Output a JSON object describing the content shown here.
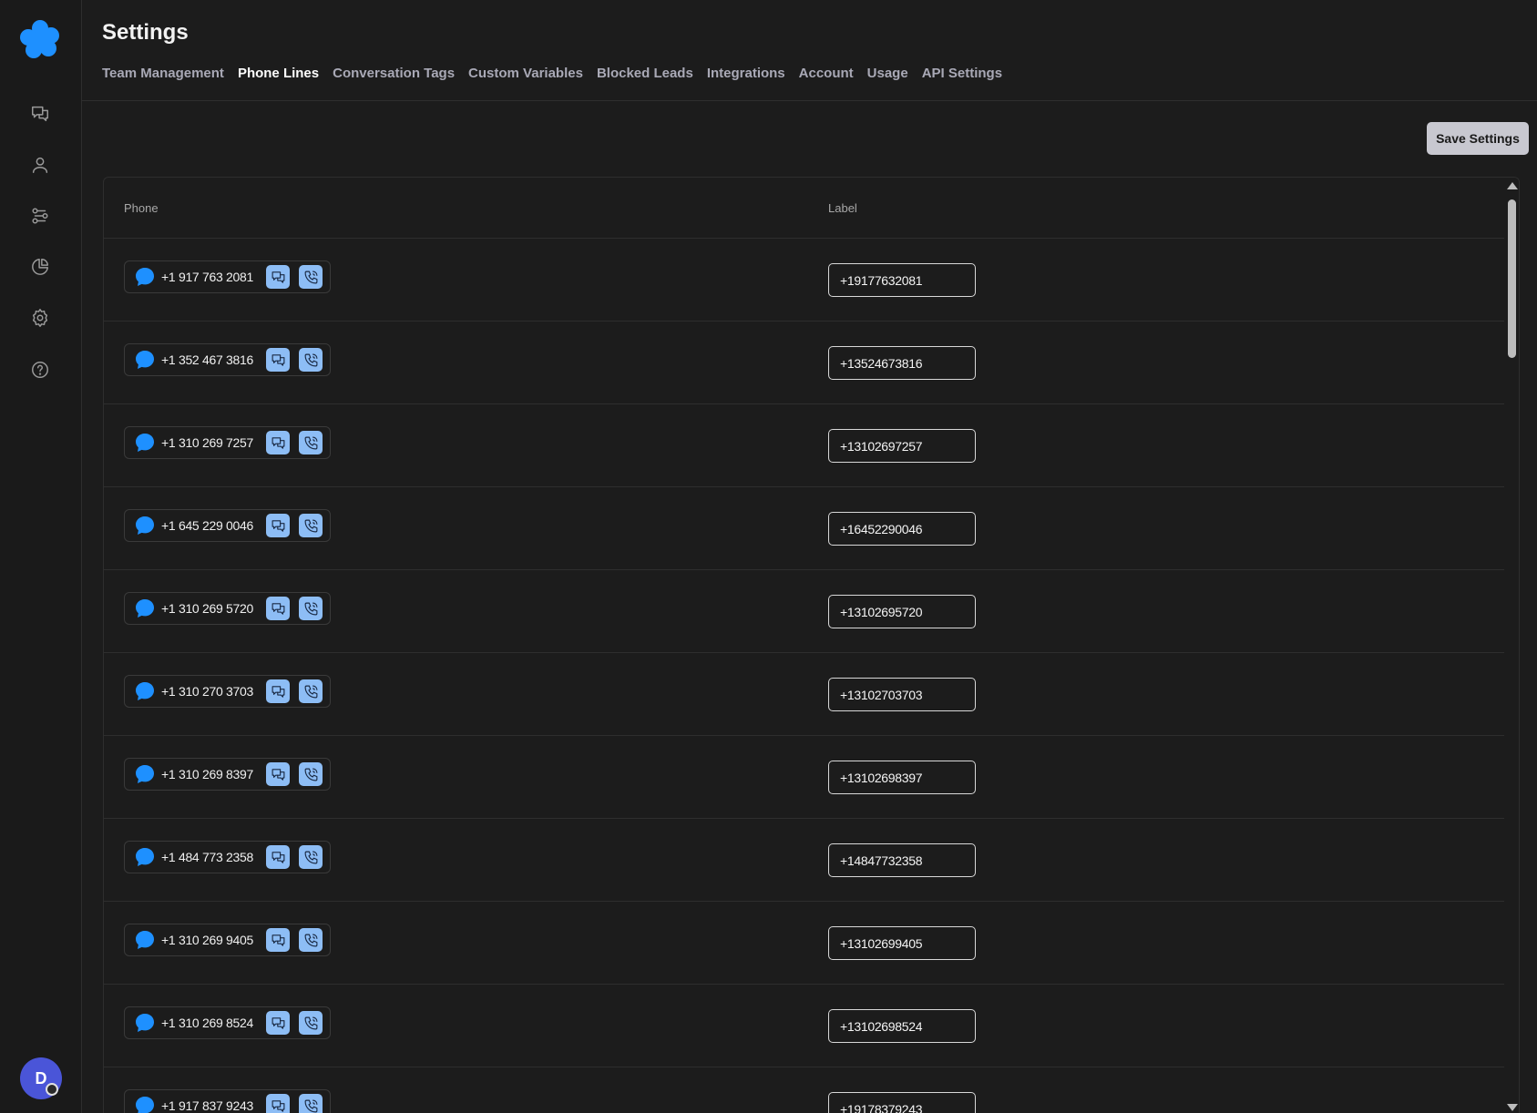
{
  "header": {
    "title": "Settings",
    "tabs": [
      {
        "label": "Team Management"
      },
      {
        "label": "Phone Lines"
      },
      {
        "label": "Conversation Tags"
      },
      {
        "label": "Custom Variables"
      },
      {
        "label": "Blocked Leads"
      },
      {
        "label": "Integrations"
      },
      {
        "label": "Account"
      },
      {
        "label": "Usage"
      },
      {
        "label": "API Settings"
      }
    ],
    "active_tab": "Phone Lines"
  },
  "sidebar": {
    "logo_color": "#1e90ff",
    "items": [
      {
        "icon": "chat-icon"
      },
      {
        "icon": "user-icon"
      },
      {
        "icon": "workflow-icon"
      },
      {
        "icon": "pie-chart-icon"
      },
      {
        "icon": "gear-icon"
      },
      {
        "icon": "help-icon"
      }
    ],
    "avatar_initial": "D"
  },
  "toolbar": {
    "save_label": "Save Settings"
  },
  "table": {
    "columns": {
      "phone": "Phone",
      "label": "Label"
    },
    "rows": [
      {
        "phone": "+1 917 763 2081",
        "label": "+19177632081"
      },
      {
        "phone": "+1 352 467 3816",
        "label": "+13524673816"
      },
      {
        "phone": "+1 310 269 7257",
        "label": "+13102697257"
      },
      {
        "phone": "+1 645 229 0046",
        "label": "+16452290046"
      },
      {
        "phone": "+1 310 269 5720",
        "label": "+13102695720"
      },
      {
        "phone": "+1 310 270 3703",
        "label": "+13102703703"
      },
      {
        "phone": "+1 310 269 8397",
        "label": "+13102698397"
      },
      {
        "phone": "+1 484 773 2358",
        "label": "+14847732358"
      },
      {
        "phone": "+1 310 269 9405",
        "label": "+13102699405"
      },
      {
        "phone": "+1 310 269 8524",
        "label": "+13102698524"
      },
      {
        "phone": "+1 917 837 9243",
        "label": "+19178379243"
      }
    ]
  },
  "colors": {
    "background": "#1c1c1c",
    "accent": "#1e90ff",
    "action_button": "#8dbdf5",
    "save_button": "#c8c8d0"
  }
}
